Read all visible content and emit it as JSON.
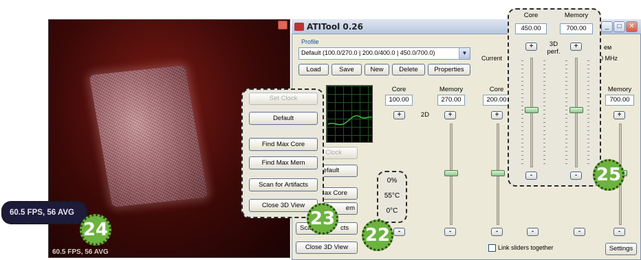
{
  "app": {
    "title": "ATITool 0.26",
    "title_buttons": [
      "_",
      "□",
      "✕"
    ]
  },
  "view3d": {
    "fps_text": "60.5 FPS, 56 AVG"
  },
  "profile": {
    "label": "Profile",
    "selected": "Default (100.0/270.0 | 200.0/400.0 | 450.0/700.0)",
    "buttons": {
      "load": "Load",
      "save": "Save",
      "new": "New",
      "delete": "Delete",
      "properties": "Properties"
    }
  },
  "current": {
    "label": "Current",
    "memory_partial": "ем",
    "mhz": "0 MHz"
  },
  "clocks": {
    "mode_2d": "2D",
    "core_2d_label": "Core",
    "core_2d_value": "100.00",
    "mem_2d_label": "Memory",
    "mem_2d_value": "270.00",
    "core_mid_label": "Core",
    "core_mid_value": "200.00",
    "mem_right_label": "Memory",
    "mem_right_value": "700.00"
  },
  "actions_panel": {
    "set_clock": "Set Clock",
    "default": "Default",
    "find_max_core": "Find Max Core",
    "find_max_mem": "Find Max Mem",
    "scan_artifacts": "Scan for Artifacts",
    "close_3d_view": "Close 3D View"
  },
  "left_partial": {
    "clock": "Clock",
    "default": "efault",
    "max_core": "ax Core",
    "max_mem": "em",
    "scan": "Sca",
    "scan_tail": "cts",
    "close_3d_view": "Close 3D View"
  },
  "temps": {
    "value1": "0%",
    "value2": "55°C",
    "value3": "0°C"
  },
  "perf3d": {
    "label": "3D perf.",
    "core_label": "Core",
    "core_value": "450.00",
    "mem_label": "Memory",
    "mem_value": "700.00"
  },
  "footer": {
    "link_sliders": "Link sliders together",
    "settings": "Settings"
  },
  "callout_numbers": {
    "n22": "22",
    "n23": "23",
    "n24": "24",
    "n25": "25"
  }
}
